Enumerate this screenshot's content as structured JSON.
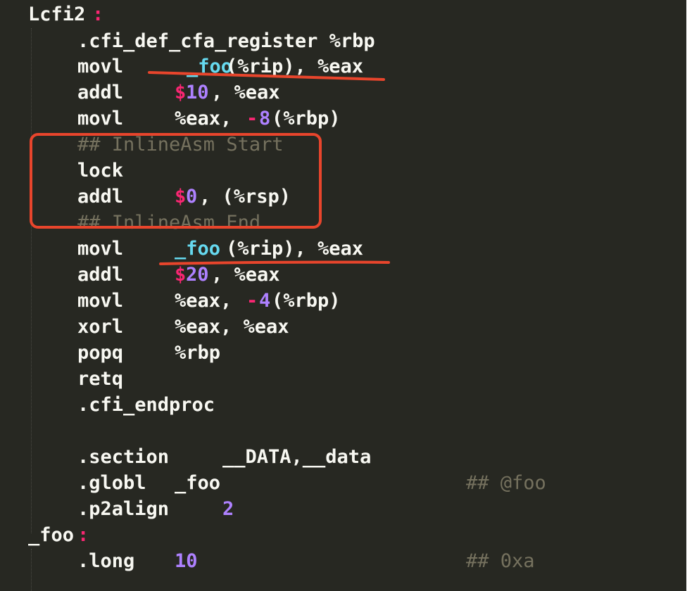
{
  "editor": {
    "theme": {
      "background": "#272822",
      "text": "#f8f8f2",
      "symbol": "#66d9ef",
      "immediate": "#ae81ff",
      "keyword_pink": "#f92672",
      "comment": "#75715e",
      "annotation_red": "#e8452c"
    },
    "lines": [
      {
        "id": "l1",
        "segs": [
          {
            "t": "Lcfi2",
            "c": "label"
          },
          {
            "t": ":",
            "c": "colon"
          }
        ]
      },
      {
        "id": "l2",
        "segs": [
          {
            "t": ".cfi_def_cfa_register %rbp",
            "c": "default"
          }
        ]
      },
      {
        "id": "l3",
        "segs": [
          {
            "t": "movl",
            "c": "default"
          },
          {
            "t": "_foo",
            "c": "sym"
          },
          {
            "t": "(%rip), %eax",
            "c": "default"
          }
        ]
      },
      {
        "id": "l4",
        "segs": [
          {
            "t": "addl",
            "c": "default"
          },
          {
            "t": "$",
            "c": "dollar"
          },
          {
            "t": "10",
            "c": "imm"
          },
          {
            "t": ", %eax",
            "c": "default"
          }
        ]
      },
      {
        "id": "l5",
        "segs": [
          {
            "t": "movl",
            "c": "default"
          },
          {
            "t": "%eax, ",
            "c": "default"
          },
          {
            "t": "-",
            "c": "minus"
          },
          {
            "t": "8",
            "c": "imm"
          },
          {
            "t": "(%rbp)",
            "c": "default"
          }
        ]
      },
      {
        "id": "l6",
        "segs": [
          {
            "t": "## InlineAsm Start",
            "c": "comment"
          }
        ]
      },
      {
        "id": "l7",
        "segs": [
          {
            "t": "lock",
            "c": "default"
          }
        ]
      },
      {
        "id": "l8",
        "segs": [
          {
            "t": "addl",
            "c": "default"
          },
          {
            "t": "$",
            "c": "dollar"
          },
          {
            "t": "0",
            "c": "imm"
          },
          {
            "t": ", (%rsp)",
            "c": "default"
          }
        ]
      },
      {
        "id": "l9",
        "segs": [
          {
            "t": "## InlineAsm End",
            "c": "comment"
          }
        ]
      },
      {
        "id": "l10",
        "segs": [
          {
            "t": "movl",
            "c": "default"
          },
          {
            "t": "_foo",
            "c": "sym"
          },
          {
            "t": "(%rip), %eax",
            "c": "default"
          }
        ]
      },
      {
        "id": "l11",
        "segs": [
          {
            "t": "addl",
            "c": "default"
          },
          {
            "t": "$",
            "c": "dollar"
          },
          {
            "t": "20",
            "c": "imm"
          },
          {
            "t": ", %eax",
            "c": "default"
          }
        ]
      },
      {
        "id": "l12",
        "segs": [
          {
            "t": "movl",
            "c": "default"
          },
          {
            "t": "%eax, ",
            "c": "default"
          },
          {
            "t": "-",
            "c": "minus"
          },
          {
            "t": "4",
            "c": "imm"
          },
          {
            "t": "(%rbp)",
            "c": "default"
          }
        ]
      },
      {
        "id": "l13",
        "segs": [
          {
            "t": "xorl",
            "c": "default"
          },
          {
            "t": "%eax, %eax",
            "c": "default"
          }
        ]
      },
      {
        "id": "l14",
        "segs": [
          {
            "t": "popq",
            "c": "default"
          },
          {
            "t": "%rbp",
            "c": "default"
          }
        ]
      },
      {
        "id": "l15",
        "segs": [
          {
            "t": "retq",
            "c": "default"
          }
        ]
      },
      {
        "id": "l16",
        "segs": [
          {
            "t": ".cfi_endproc",
            "c": "default"
          }
        ]
      },
      {
        "id": "l17",
        "segs": []
      },
      {
        "id": "l18",
        "segs": [
          {
            "t": ".section",
            "c": "default"
          },
          {
            "t": "__DATA,__data",
            "c": "default"
          }
        ]
      },
      {
        "id": "l19",
        "segs": [
          {
            "t": ".globl",
            "c": "default"
          },
          {
            "t": "_foo",
            "c": "default"
          },
          {
            "t": "## @foo",
            "c": "comment"
          }
        ]
      },
      {
        "id": "l20",
        "segs": [
          {
            "t": ".p2align",
            "c": "default"
          },
          {
            "t": "2",
            "c": "imm"
          }
        ]
      },
      {
        "id": "l21",
        "segs": [
          {
            "t": "_foo",
            "c": "label"
          },
          {
            "t": ":",
            "c": "colon"
          }
        ]
      },
      {
        "id": "l22",
        "segs": [
          {
            "t": ".long",
            "c": "default"
          },
          {
            "t": "10",
            "c": "imm"
          },
          {
            "t": "## 0xa",
            "c": "comment"
          }
        ]
      }
    ]
  },
  "annotations": [
    {
      "kind": "underline",
      "label": "first _foo load underline"
    },
    {
      "kind": "box",
      "label": "inline asm box"
    },
    {
      "kind": "underline",
      "label": "second _foo load underline"
    }
  ]
}
